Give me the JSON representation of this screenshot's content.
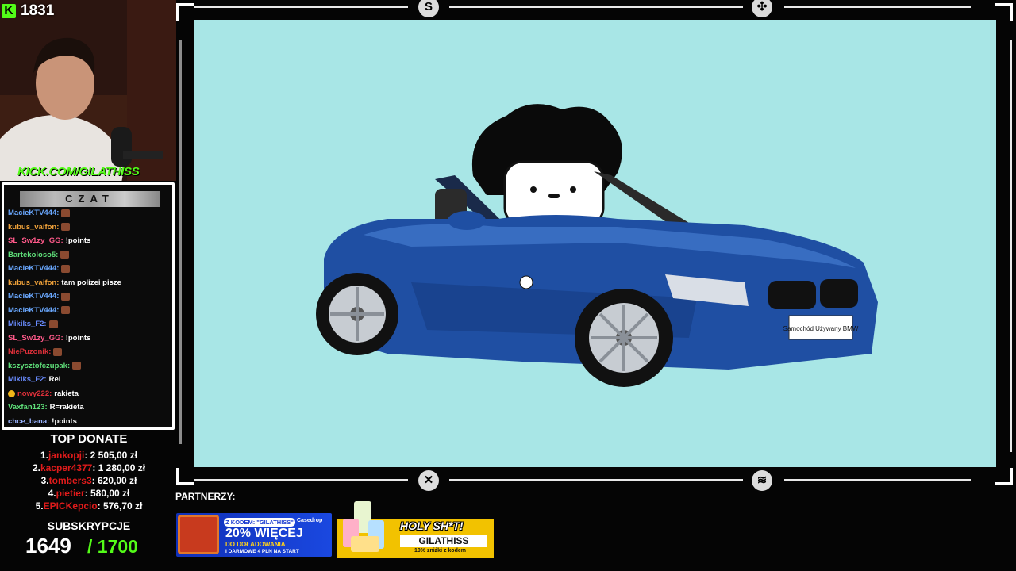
{
  "stream": {
    "viewer_count": "1831",
    "kick_logo": "K",
    "url": "KICK.COM/GILATHISS"
  },
  "chat": {
    "title": "CZAT",
    "messages": [
      {
        "user": "MacieKTV444:",
        "color": "#6aa8ff",
        "text": "",
        "emote": true
      },
      {
        "user": "kubus_vaifon:",
        "color": "#f0a23a",
        "text": "",
        "emote": true
      },
      {
        "user": "SL_Sw1zy_GG:",
        "color": "#ff5a8a",
        "text": "!points",
        "emote": false
      },
      {
        "user": "Bartekoloso5:",
        "color": "#5fe07a",
        "text": "",
        "emote": true
      },
      {
        "user": "MacieKTV444:",
        "color": "#6aa8ff",
        "text": "",
        "emote": true
      },
      {
        "user": "kubus_vaifon:",
        "color": "#f0a23a",
        "text": "tam polizei pisze",
        "emote": false
      },
      {
        "user": "MacieKTV444:",
        "color": "#6aa8ff",
        "text": "",
        "emote": true
      },
      {
        "user": "MacieKTV444:",
        "color": "#6aa8ff",
        "text": "",
        "emote": true
      },
      {
        "user": "Mikiks_F2:",
        "color": "#6a8cff",
        "text": "",
        "emote": true
      },
      {
        "user": "SL_Sw1zy_GG:",
        "color": "#ff5a8a",
        "text": "!points",
        "emote": false
      },
      {
        "user": "NiePuzonik:",
        "color": "#e0303a",
        "text": "",
        "emote": true
      },
      {
        "user": "kszysztofczupak:",
        "color": "#5fe07a",
        "text": "",
        "emote": true
      },
      {
        "user": "Mikiks_F2:",
        "color": "#6a8cff",
        "text": "Rel",
        "emote": false
      },
      {
        "user": "nowy222:",
        "color": "#e0303a",
        "text": "rakieta",
        "emote": false,
        "coin": true
      },
      {
        "user": "Vaxfan123:",
        "color": "#5fe07a",
        "text": "R=rakieta",
        "emote": false
      },
      {
        "user": "chce_bana:",
        "color": "#9ab4ff",
        "text": "!points",
        "emote": false
      }
    ]
  },
  "top_donate": {
    "title": "TOP DONATE",
    "entries": [
      {
        "rank": "1.",
        "name": "jankopji",
        "amount": ": 2 505,00 zł"
      },
      {
        "rank": "2.",
        "name": "kacper4377",
        "amount": ": 1 280,00 zł"
      },
      {
        "rank": "3.",
        "name": "tombers3",
        "amount": ": 620,00 zł"
      },
      {
        "rank": "4.",
        "name": "pietier",
        "amount": ": 580,00 zł"
      },
      {
        "rank": "5.",
        "name": "EPICKepcio",
        "amount": ": 576,70 zł"
      }
    ]
  },
  "subscriptions": {
    "title": "SUBSKRYPCJE",
    "current": "1649",
    "goal": "/ 1700"
  },
  "frame": {
    "top_icons": [
      "S",
      "✣"
    ],
    "bottom_icons": [
      "✕",
      "≋"
    ]
  },
  "stage": {
    "background": "#a8e6e6",
    "plate_text": "Samochód Używany BMW"
  },
  "partners": {
    "label": "PARTNERZY:",
    "banner1": {
      "code": "Z KODEM: \"GILATHISS\"",
      "brand": "Casedrop",
      "main": "20% WIĘCEJ",
      "sub1": "DO DOŁADOWANIA",
      "sub2": "I DARMOWE 4 PLN NA START"
    },
    "banner2": {
      "title": "HOLY SH*T!",
      "code": "GILATHISS",
      "note": "10% zniżki z kodem"
    }
  },
  "colors": {
    "kick_green": "#53fc18",
    "donor_red": "#e01b1b"
  }
}
